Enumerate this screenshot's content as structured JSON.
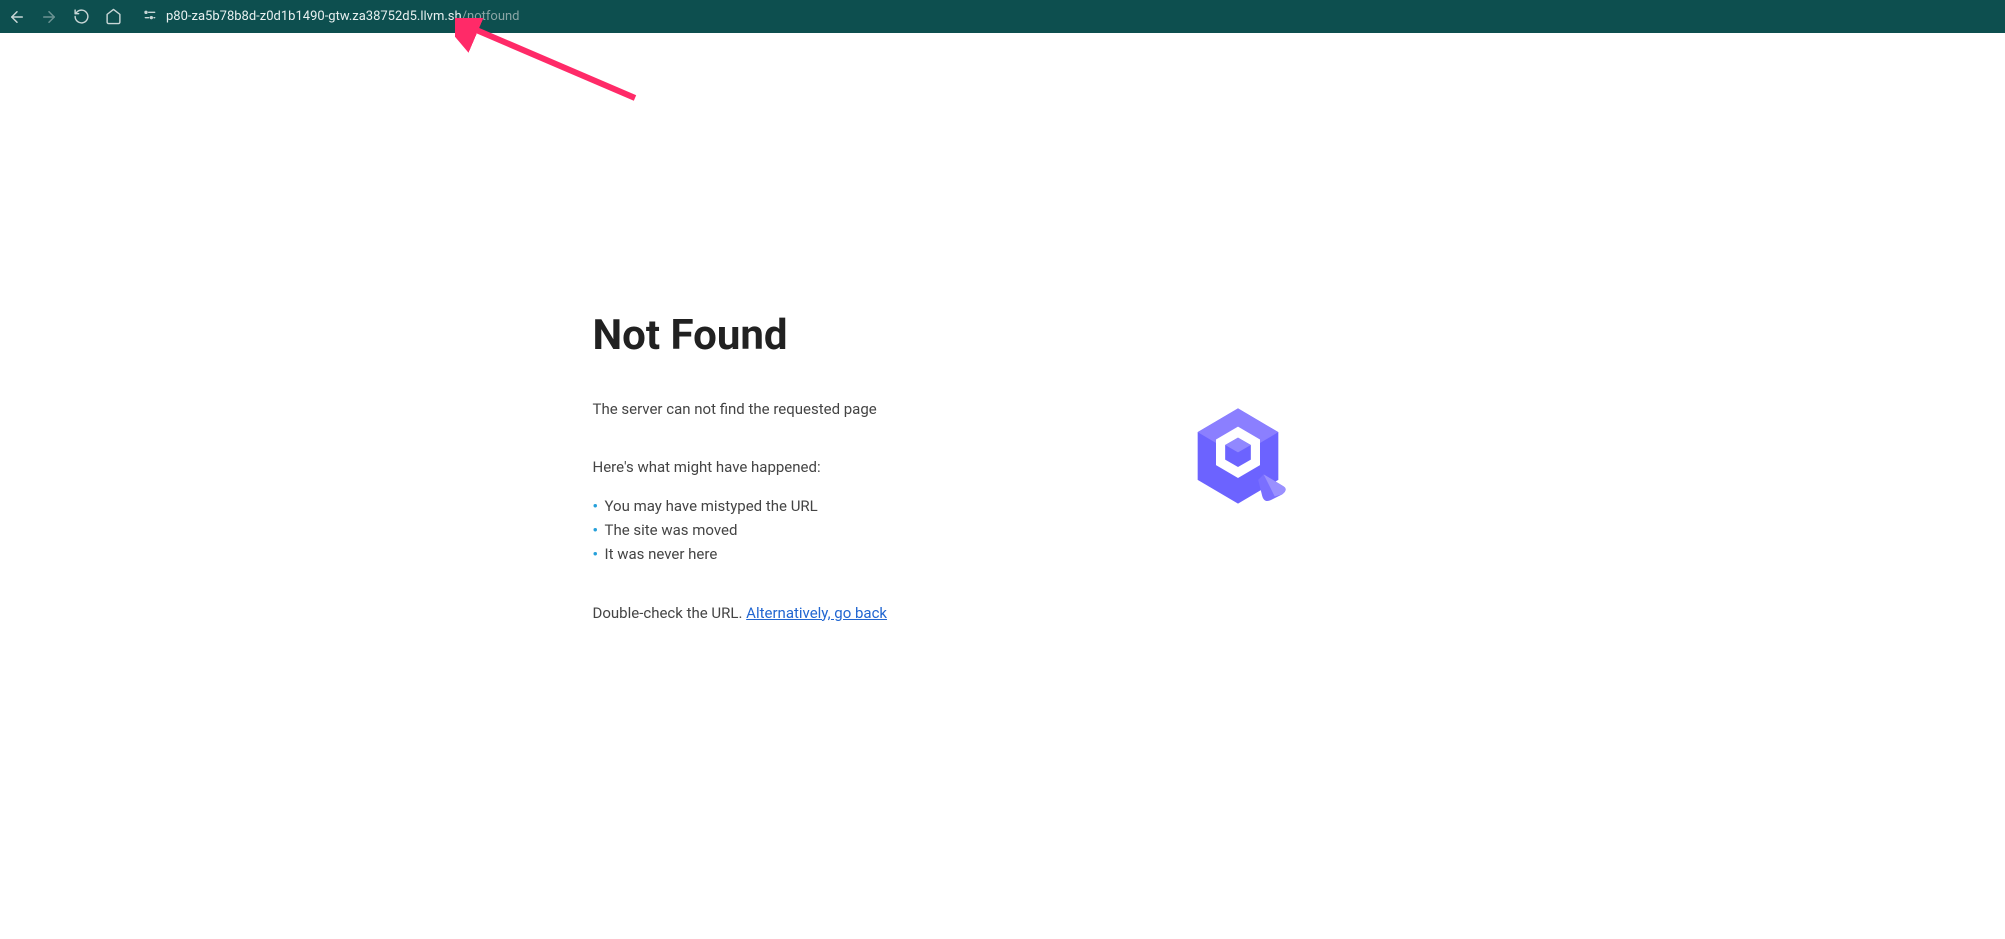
{
  "browser": {
    "url_host": "p80-za5b78b8d-z0d1b1490-gtw.za38752d5.llvm.sh",
    "url_path": "/notfound"
  },
  "error": {
    "title": "Not Found",
    "subtitle": "The server can not find the requested page",
    "hint": "Here's what might have happened:",
    "reasons": [
      "You may have mistyped the URL",
      "The site was moved",
      "It was never here"
    ],
    "footer_text": "Double-check the URL. ",
    "footer_link": "Alternatively, go back"
  }
}
